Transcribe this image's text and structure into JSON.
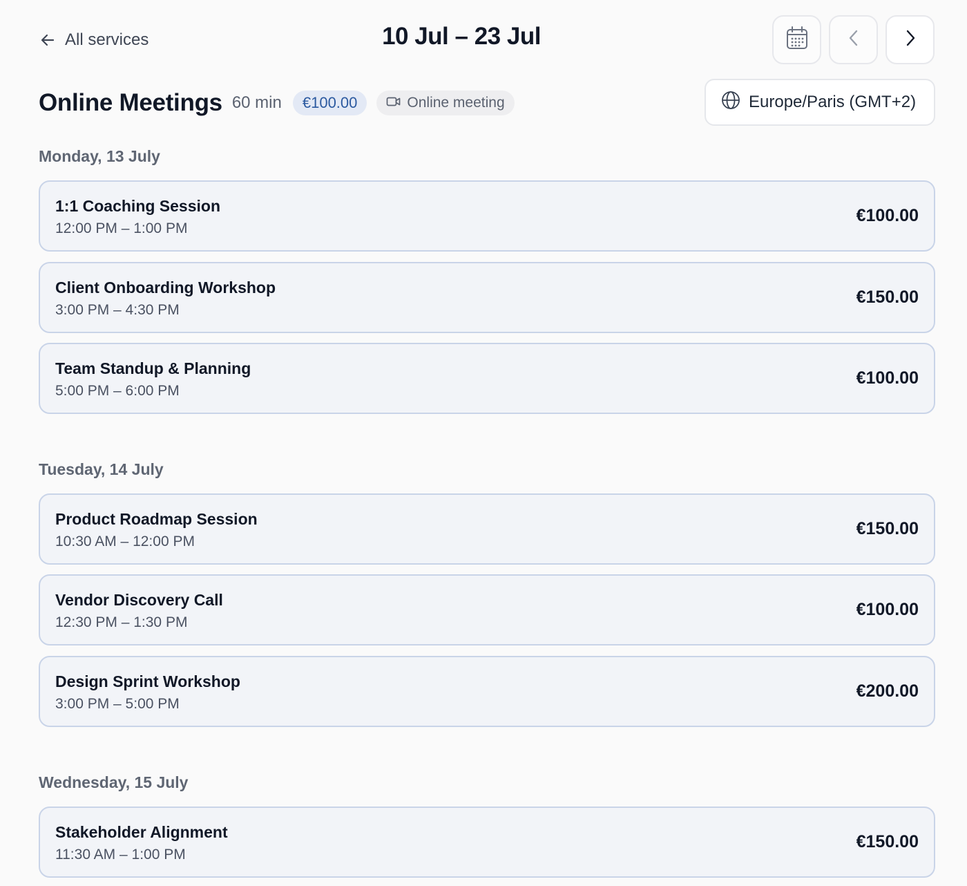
{
  "header": {
    "back_label": "All services",
    "date_range": "10 Jul – 23 Jul",
    "icons": {
      "back": "arrow-left-icon",
      "calendar": "calendar-icon",
      "prev": "chevron-left-icon",
      "next": "chevron-right-icon"
    }
  },
  "service": {
    "name": "Online Meetings",
    "duration": "60 min",
    "price": "€100.00",
    "meeting_type": "Online meeting",
    "meeting_type_icon": "video-camera-icon",
    "timezone": "Europe/Paris (GMT+2)",
    "timezone_icon": "globe-icon"
  },
  "days": [
    {
      "label": "Monday, 13 July",
      "slots": [
        {
          "title": "1:1 Coaching Session",
          "time": "12:00 PM – 1:00 PM",
          "price": "€100.00"
        },
        {
          "title": "Client Onboarding Workshop",
          "time": "3:00 PM – 4:30 PM",
          "price": "€150.00"
        },
        {
          "title": "Team Standup & Planning",
          "time": "5:00 PM – 6:00 PM",
          "price": "€100.00"
        }
      ]
    },
    {
      "label": "Tuesday, 14 July",
      "slots": [
        {
          "title": "Product Roadmap Session",
          "time": "10:30 AM – 12:00 PM",
          "price": "€150.00"
        },
        {
          "title": "Vendor Discovery Call",
          "time": "12:30 PM – 1:30 PM",
          "price": "€100.00"
        },
        {
          "title": "Design Sprint Workshop",
          "time": "3:00 PM – 5:00 PM",
          "price": "€200.00"
        }
      ]
    },
    {
      "label": "Wednesday, 15 July",
      "slots": [
        {
          "title": "Stakeholder Alignment",
          "time": "11:30 AM – 1:00 PM",
          "price": "€150.00"
        }
      ]
    }
  ],
  "colors": {
    "background": "#fafafa",
    "slot_border": "#c9d4e8",
    "slot_background": "#f2f4f8",
    "price_pill_background": "#e3e9f5",
    "price_pill_text": "#2c5aa0"
  }
}
